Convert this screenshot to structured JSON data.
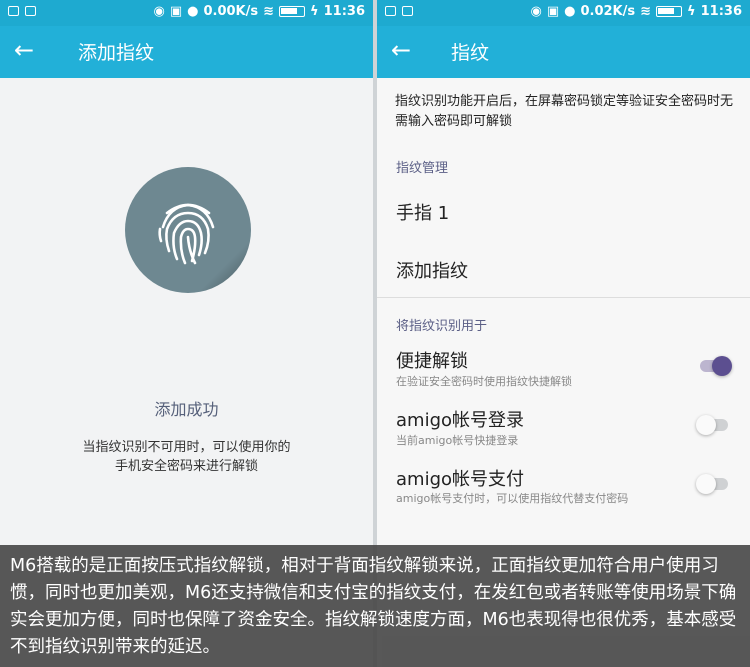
{
  "left": {
    "status": {
      "speed": "0.00K/s",
      "time": "11:36"
    },
    "appbar": {
      "title": "添加指纹"
    },
    "success_text": "添加成功",
    "note_line1": "当指纹识别不可用时，可以使用你的",
    "note_line2": "手机安全密码来进行解锁"
  },
  "right": {
    "status": {
      "speed": "0.02K/s",
      "time": "11:36"
    },
    "appbar": {
      "title": "指纹"
    },
    "description": "指纹识别功能开启后，在屏幕密码锁定等验证安全密码时无需输入密码即可解锁",
    "manage_header": "指纹管理",
    "finger1": "手指 1",
    "add_fingerprint": "添加指纹",
    "use_header": "将指纹识别用于",
    "options": [
      {
        "title": "便捷解锁",
        "subtitle": "在验证安全密码时使用指纹快捷解锁",
        "enabled": true
      },
      {
        "title": "amigo帐号登录",
        "subtitle": "当前amigo帐号快捷登录",
        "enabled": false
      },
      {
        "title": "amigo帐号支付",
        "subtitle": "amigo帐号支付时，可以使用指纹代替支付密码",
        "enabled": false
      }
    ]
  },
  "caption": "M6搭载的是正面按压式指纹解锁，相对于背面指纹解锁来说，正面指纹更加符合用户使用习惯，同时也更加美观，M6还支持微信和支付宝的指纹支付，在发红包或者转账等使用场景下确实会更加方便，同时也保障了资金安全。指纹解锁速度方面，M6也表现得也很优秀，基本感受不到指纹识别带来的延迟。",
  "colors": {
    "status_bar": "#1eaad0",
    "app_bar": "#22b0d8",
    "toggle_on": "#5c4f90"
  }
}
